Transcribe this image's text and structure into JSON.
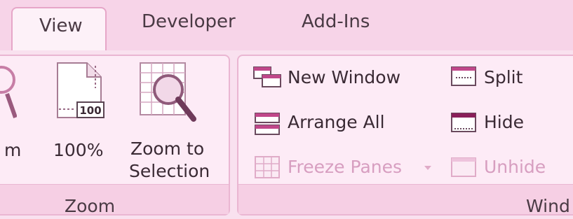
{
  "tabs": {
    "view": "View",
    "developer": "Developer",
    "addins": "Add-Ins"
  },
  "zoom_group": {
    "zoom_partial": "m",
    "hundred_label": "100%",
    "hundred_icon_text": "100",
    "zoom_to_selection_line1": "Zoom to",
    "zoom_to_selection_line2": "Selection",
    "group_label": "Zoom"
  },
  "window_group": {
    "new_window": "New Window",
    "arrange_all": "Arrange All",
    "freeze_panes": "Freeze Panes",
    "split": "Split",
    "hide": "Hide",
    "unhide": "Unhide",
    "group_label_partial": "Wind"
  }
}
